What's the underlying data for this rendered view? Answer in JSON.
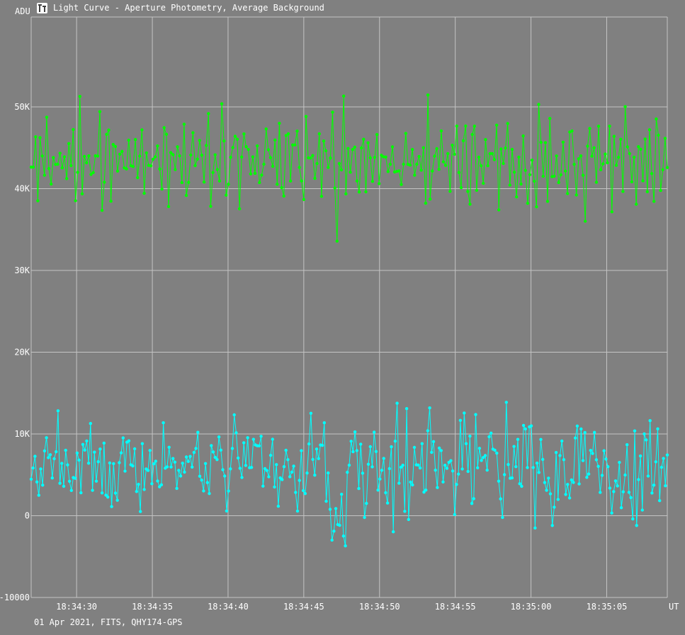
{
  "window": {
    "title": "Light Curve - Aperture Photometry, Average Background",
    "icon": "light-curve-app-icon"
  },
  "footer": {
    "caption": "01 Apr 2021, FITS, QHY174-GPS"
  },
  "colors": {
    "background": "#808080",
    "grid": "#c4c4c4",
    "axis_text": "#ffffff",
    "series_green": "#00ff00",
    "series_cyan": "#00ffff"
  },
  "chart_data": {
    "type": "line",
    "title": "",
    "xlabel": "UT",
    "ylabel": "ADU",
    "xlim": [
      "18:34:27.0",
      "18:35:09.0"
    ],
    "ylim": [
      -10000,
      61000
    ],
    "grid": true,
    "markers": true,
    "legend": "none",
    "x_tick_labels": [
      "18:34:30",
      "18:34:35",
      "18:34:40",
      "18:34:45",
      "18:34:50",
      "18:34:55",
      "18:35:00",
      "18:35:05"
    ],
    "x_tick_values": [
      30,
      35,
      40,
      45,
      50,
      55,
      60,
      65
    ],
    "y_tick_labels": [
      "-10000",
      "0",
      "10K",
      "20K",
      "30K",
      "40K",
      "50K"
    ],
    "y_tick_values": [
      -10000,
      0,
      10000,
      20000,
      30000,
      40000,
      50000
    ],
    "x_unit": "seconds after 18:34:00 UT",
    "series": [
      {
        "color": "#00ff00",
        "values": [
          42631,
          42642,
          46338,
          38525,
          46233,
          44004,
          41649,
          48741,
          42463,
          40570,
          43802,
          42968,
          42988,
          44343,
          42549,
          43892,
          41236,
          45520,
          42827,
          47232,
          38533,
          42001,
          51282,
          39372,
          43955,
          43160,
          44016,
          41743,
          41972,
          44022,
          43997,
          49426,
          37351,
          40789,
          46644,
          47174,
          38473,
          45410,
          45157,
          42152,
          44224,
          44567,
          42546,
          42409,
          45924,
          42811,
          42711,
          46013,
          41351,
          43983,
          47190,
          39434,
          44386,
          42851,
          42787,
          43605,
          43893,
          45228,
          42412,
          39951,
          47469,
          46656,
          37810,
          44414,
          44155,
          42342,
          45132,
          44013,
          40748,
          47885,
          39170,
          40764,
          44120,
          46839,
          42828,
          43619,
          45899,
          44096,
          40812,
          45289,
          49178,
          37845,
          41975,
          44146,
          42339,
          40934,
          50381,
          45839,
          39203,
          40539,
          43840,
          45025,
          46407,
          46051,
          37543,
          43873,
          46698,
          45138,
          44795,
          41804,
          43893,
          41870,
          45232,
          40751,
          41665,
          42989,
          47304,
          44774,
          43798,
          42740,
          45949,
          40541,
          47991,
          40125,
          39100,
          46503,
          46713,
          40940,
          45358,
          45354,
          47045,
          42598,
          40948,
          38680,
          48825,
          43776,
          43742,
          44055,
          41258,
          43077,
          46713,
          39067,
          45830,
          44648,
          42592,
          43751,
          49353,
          40081,
          33587,
          43080,
          42300,
          51331,
          39370,
          44924,
          42012,
          44785,
          45088,
          40945,
          39600,
          44979,
          46043,
          39618,
          45618,
          43772,
          40893,
          43827,
          46619,
          40618,
          44094,
          43888,
          43877,
          42102,
          42978,
          45121,
          42047,
          42122,
          42164,
          40514,
          42993,
          46753,
          42976,
          42883,
          44791,
          41658,
          42994,
          43935,
          42260,
          45004,
          38221,
          51458,
          38731,
          42155,
          43985,
          44897,
          42366,
          47070,
          43287,
          42853,
          44287,
          39674,
          45323,
          44204,
          47653,
          41981,
          40120,
          45867,
          47665,
          39668,
          38107,
          46631,
          47649,
          39806,
          43858,
          42811,
          40652,
          46007,
          42812,
          44286,
          44298,
          43557,
          47773,
          37417,
          44854,
          43084,
          44969,
          47972,
          40447,
          44802,
          42008,
          38996,
          43862,
          40563,
          46451,
          42233,
          38212,
          41711,
          43493,
          40920,
          37788,
          50307,
          45664,
          41522,
          45627,
          38452,
          48591,
          41474,
          41525,
          44007,
          40755,
          41712,
          45690,
          42169,
          39406,
          46931,
          47062,
          42972,
          39236,
          43653,
          44010,
          41638,
          36017,
          45202,
          47364,
          43976,
          45008,
          40782,
          47637,
          42326,
          43046,
          44240,
          43169,
          47647,
          37170,
          46403,
          42849,
          43839,
          46048,
          39662,
          50030,
          45119,
          44296,
          40840,
          43850,
          38100,
          45138,
          44823,
          40964,
          46081,
          39628,
          47211,
          41850,
          38450,
          48526,
          46543,
          39779,
          42315,
          46156,
          42587
        ],
        "x_start": 27.0,
        "x_end": 69.0
      },
      {
        "color": "#00ffff",
        "values": [
          4469,
          5839,
          7269,
          4134,
          2506,
          5720,
          3745,
          7930,
          9542,
          7098,
          7461,
          4614,
          6970,
          7830,
          12832,
          3964,
          6398,
          3605,
          8004,
          6219,
          4218,
          3093,
          4671,
          4570,
          7672,
          6794,
          2809,
          8717,
          8026,
          9147,
          6428,
          11280,
          3112,
          7773,
          4223,
          6608,
          8161,
          2790,
          8882,
          2523,
          2280,
          6447,
          1116,
          6373,
          2769,
          1888,
          6485,
          7693,
          9514,
          5458,
          8994,
          9163,
          6238,
          6085,
          8181,
          2966,
          3833,
          512,
          8816,
          3213,
          5727,
          5530,
          7988,
          3912,
          6351,
          6667,
          4249,
          3540,
          3783,
          11369,
          5821,
          5985,
          8376,
          5962,
          6996,
          6553,
          3346,
          5547,
          4858,
          6425,
          5330,
          7188,
          6645,
          7256,
          5951,
          7739,
          8234,
          10203,
          4835,
          4356,
          3027,
          6385,
          4055,
          2709,
          8580,
          7802,
          7136,
          6864,
          9637,
          8031,
          5626,
          4860,
          583,
          3022,
          5735,
          8227,
          12342,
          10151,
          7061,
          5802,
          4677,
          8926,
          6151,
          9545,
          5869,
          5906,
          9341,
          8660,
          8552,
          8546,
          9713,
          3624,
          5762,
          5531,
          4760,
          7389,
          9349,
          3520,
          6252,
          1165,
          4625,
          4413,
          6001,
          8002,
          6862,
          4771,
          5334,
          6066,
          2853,
          568,
          4324,
          7958,
          3071,
          2709,
          5221,
          8778,
          12533,
          6880,
          4964,
          8157,
          6984,
          8653,
          8608,
          11372,
          1765,
          5228,
          789,
          -2974,
          -1890,
          877,
          -1079,
          -1181,
          2624,
          -2488,
          -3688,
          5311,
          6181,
          9113,
          7830,
          10251,
          7970,
          3325,
          8751,
          5208,
          -205,
          1505,
          6292,
          8439,
          5981,
          10217,
          7855,
          3131,
          4483,
          5562,
          7008,
          2813,
          1549,
          5770,
          8436,
          -1961,
          9115,
          13763,
          3975,
          5933,
          6177,
          534,
          13099,
          -460,
          4112,
          3770,
          8357,
          6224,
          6203,
          5840,
          8817,
          2888,
          3133,
          10398,
          13188,
          7748,
          9064,
          5566,
          3447,
          8280,
          7975,
          4130,
          6177,
          5791,
          6522,
          6734,
          5472,
          146,
          3829,
          5095,
          11663,
          5712,
          12567,
          8818,
          5421,
          9736,
          1498,
          2083,
          12371,
          5863,
          8240,
          6766,
          7119,
          7358,
          5580,
          9667,
          10102,
          8150,
          8021,
          7657,
          4226,
          2059,
          -209,
          5022,
          13871,
          6264,
          4580,
          4624,
          8467,
          6002,
          9334,
          3917,
          3604,
          11045,
          10611,
          5890,
          10868,
          10984,
          5900,
          -1496,
          6432,
          5294,
          9328,
          6885,
          4063,
          3111,
          4596,
          2677,
          -1196,
          1046,
          7736,
          1990,
          7358,
          9133,
          6856,
          2610,
          3830,
          2177,
          4381,
          4070,
          9504,
          10974,
          3886,
          10606,
          6749,
          10180,
          4691,
          5101,
          7990,
          7614,
          10195,
          6846,
          6035,
          2845,
          4933,
          7946,
          6932,
          6004,
          3379,
          326,
          2950,
          4263,
          3645,
          6520,
          981,
          2924,
          4975,
          8684,
          2868,
          2219,
          -398,
          10372,
          -1193,
          4428,
          7309,
          689,
          10011,
          9276,
          4851,
          11627,
          2784,
          3745,
          6597,
          10623,
          1841,
          5920,
          7004,
          3663,
          7430
        ],
        "x_start": 27.0,
        "x_end": 69.0
      }
    ]
  }
}
